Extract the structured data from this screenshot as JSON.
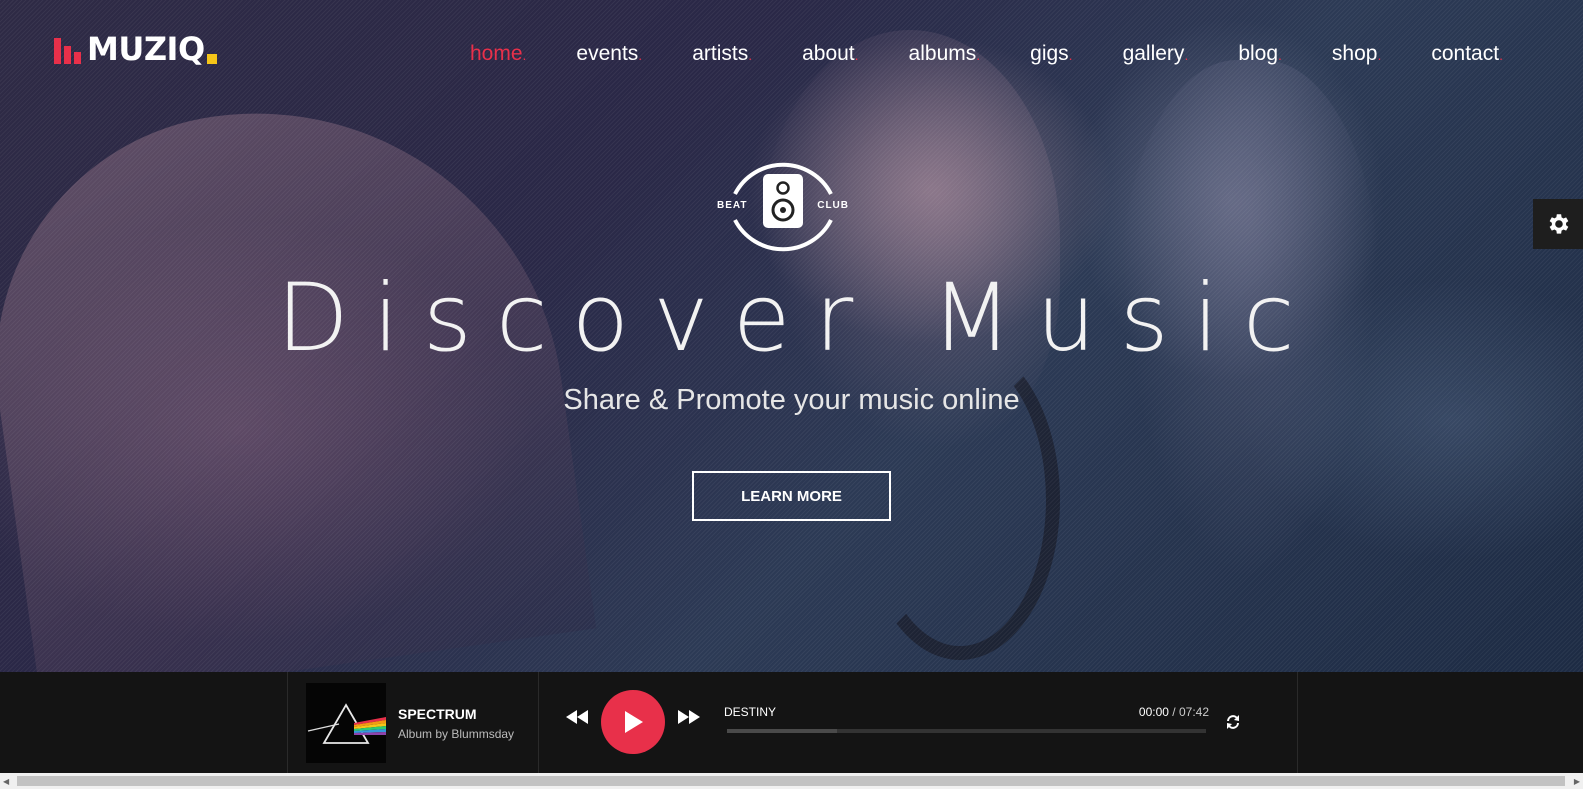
{
  "brand": {
    "name": "MUZIQ",
    "accent": "#e8304a",
    "dot_color": "#f5c518"
  },
  "nav": {
    "items": [
      {
        "label": "home",
        "active": true
      },
      {
        "label": "events"
      },
      {
        "label": "artists"
      },
      {
        "label": "about"
      },
      {
        "label": "albums"
      },
      {
        "label": "gigs"
      },
      {
        "label": "gallery"
      },
      {
        "label": "blog"
      },
      {
        "label": "shop"
      },
      {
        "label": "contact"
      }
    ],
    "dot": "."
  },
  "hero": {
    "badge_left": "BEAT",
    "badge_right": "CLUB",
    "headline": "Discover Music",
    "subline": "Share & Promote your music online",
    "cta": "LEARN MORE"
  },
  "settings": {
    "icon": "gear-icon"
  },
  "player": {
    "album_title": "SPECTRUM",
    "album_sub": "Album by Blummsday",
    "now_playing": "DESTINY",
    "current_time": "00:00",
    "separator": "/",
    "duration": "07:42",
    "progress": 0.23,
    "icons": {
      "prev": "rewind-icon",
      "play": "play-icon",
      "next": "fast-forward-icon",
      "repeat": "repeat-icon"
    }
  }
}
